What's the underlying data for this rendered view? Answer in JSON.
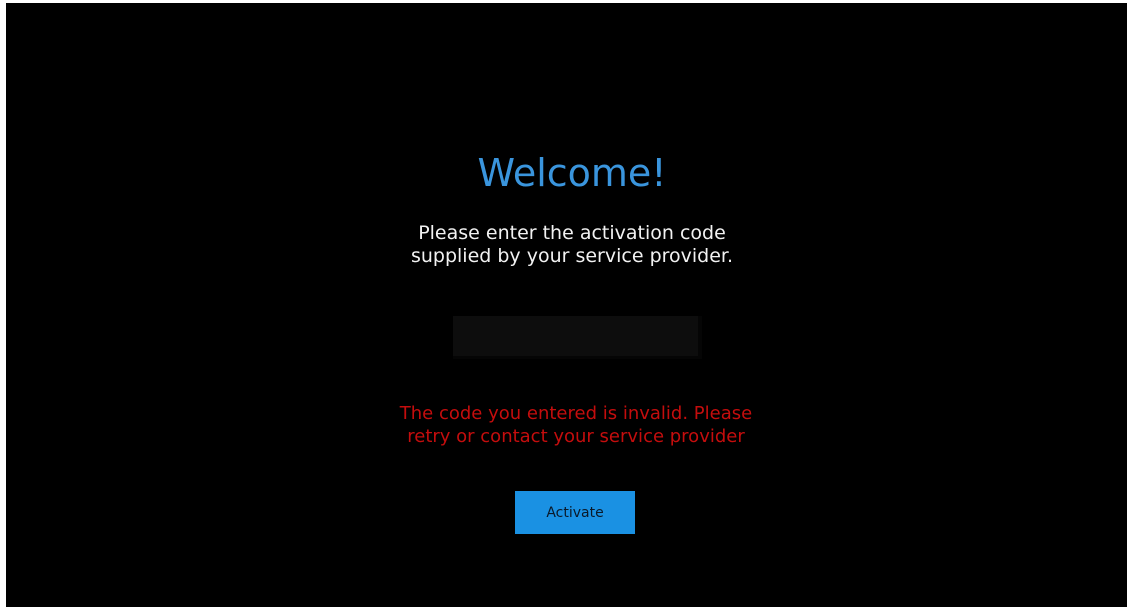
{
  "welcome": {
    "title": "Welcome!",
    "instruction_line1": "Please enter the activation code",
    "instruction_line2": "supplied by your service provider."
  },
  "activation": {
    "code_value": "",
    "error_line1": "The code you entered is invalid. Please",
    "error_line2": "retry or contact your service provider",
    "activate_label": "Activate"
  },
  "colors": {
    "background": "#000000",
    "title": "#3a95dd",
    "error": "#c40d0d",
    "button": "#1a91e3"
  }
}
